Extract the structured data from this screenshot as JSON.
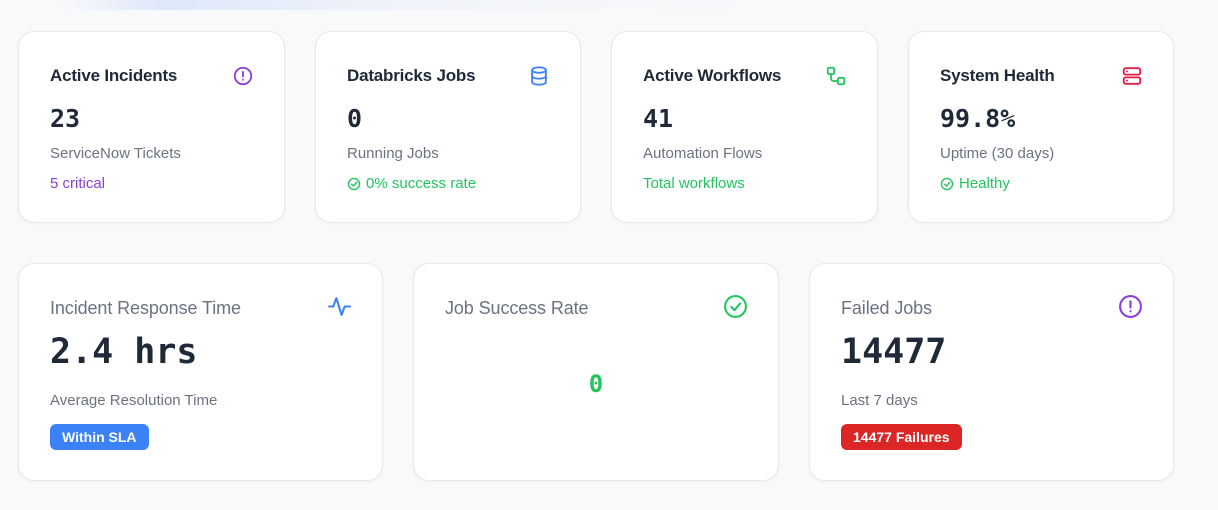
{
  "top_cards": [
    {
      "title": "Active Incidents",
      "icon": "alert-circle-icon",
      "icon_color": "#8b3fd9",
      "value": "23",
      "subtitle": "ServiceNow Tickets",
      "footer": "5 critical",
      "footer_color": "#8b3fd9"
    },
    {
      "title": "Databricks Jobs",
      "icon": "database-icon",
      "icon_color": "#3b82f6",
      "value": "0",
      "subtitle": "Running Jobs",
      "footer": "0% success rate",
      "footer_color": "#22c55e"
    },
    {
      "title": "Active Workflows",
      "icon": "workflow-icon",
      "icon_color": "#22c55e",
      "value": "41",
      "subtitle": "Automation Flows",
      "footer": "Total workflows",
      "footer_color": "#22c55e"
    },
    {
      "title": "System Health",
      "icon": "server-icon",
      "icon_color": "#e11d48",
      "value": "99.8%",
      "subtitle": "Uptime (30 days)",
      "footer": "Healthy",
      "footer_color": "#22c55e"
    }
  ],
  "bottom_cards": [
    {
      "title": "Incident Response Time",
      "icon": "activity-icon",
      "icon_color": "#3b82f6",
      "value": "2.4 hrs",
      "subtitle": "Average Resolution Time",
      "badge": "Within SLA",
      "badge_color": "#3b82f6"
    },
    {
      "title": "Job Success Rate",
      "icon": "check-circle-icon",
      "icon_color": "#22c55e",
      "value": "0"
    },
    {
      "title": "Failed Jobs",
      "icon": "alert-circle-icon",
      "icon_color": "#8b3fd9",
      "value": "14477",
      "subtitle": "Last 7 days",
      "badge": "14477 Failures",
      "badge_color": "#dc2626"
    }
  ]
}
